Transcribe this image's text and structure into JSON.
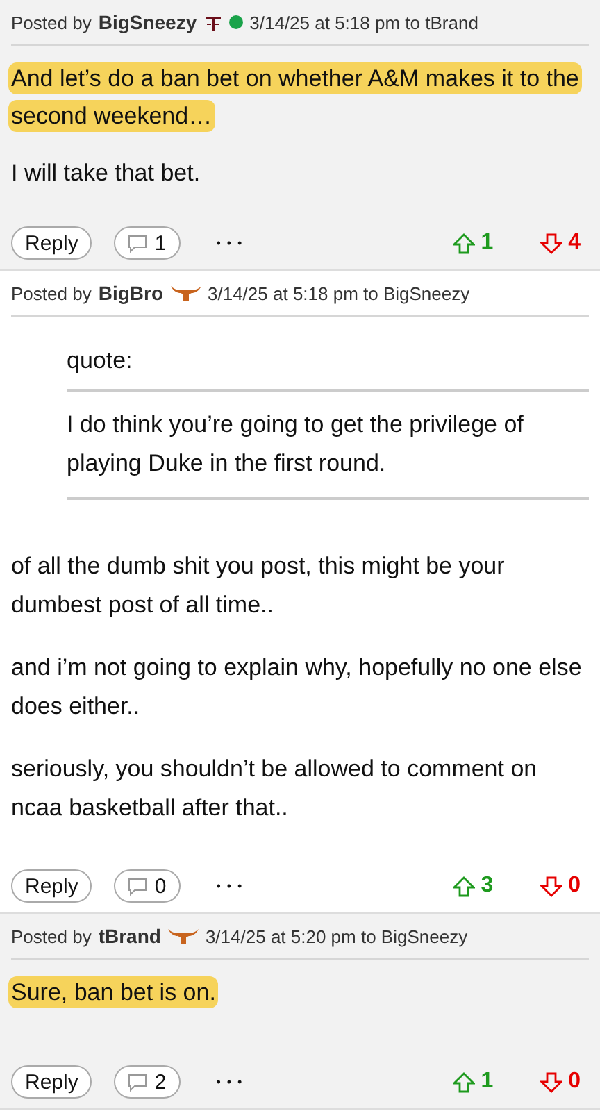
{
  "posts": [
    {
      "posted_by": "Posted by",
      "author": "BigSneezy",
      "kind": "aggie",
      "online": true,
      "meta": "3/14/25 at 5:18 pm to tBrand",
      "paragraphs": [
        {
          "text": "And let’s do a ban bet on whether A&M makes it to the second weekend…",
          "highlighted": true
        },
        {
          "text": "I will take that bet.",
          "highlighted": false
        }
      ],
      "reply": "Reply",
      "comments": "1",
      "more": "• • •",
      "up": "1",
      "down": "4"
    },
    {
      "posted_by": "Posted by",
      "author": "BigBro",
      "kind": "longhorn",
      "online": false,
      "meta": "3/14/25 at 5:18 pm to BigSneezy",
      "quote": {
        "label": "quote:",
        "text": "I do think you’re going to get the privilege of playing Duke in the first round."
      },
      "paragraphs": [
        {
          "text": "of all the dumb shit you post, this might be your dumbest post of all time..",
          "highlighted": false
        },
        {
          "text": "and i’m not going to explain why, hopefully no one else does either..",
          "highlighted": false
        },
        {
          "text": "seriously, you shouldn’t be allowed to comment on ncaa basketball after that..",
          "highlighted": false
        }
      ],
      "reply": "Reply",
      "comments": "0",
      "more": "• • •",
      "up": "3",
      "down": "0"
    },
    {
      "posted_by": "Posted by",
      "author": "tBrand",
      "kind": "longhorn",
      "online": false,
      "meta": "3/14/25 at 5:20 pm to BigSneezy",
      "paragraphs": [
        {
          "text": "Sure, ban bet is on.",
          "highlighted": true
        }
      ],
      "reply": "Reply",
      "comments": "2",
      "more": "• • •",
      "up": "1",
      "down": "0"
    }
  ]
}
